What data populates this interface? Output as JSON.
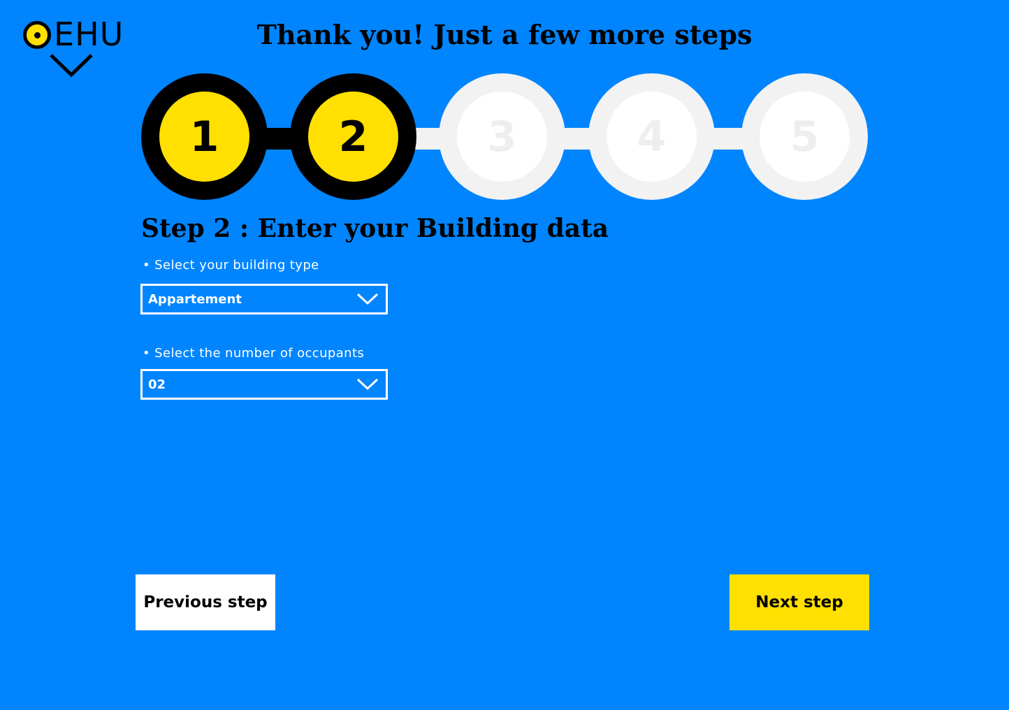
{
  "brand": {
    "name": "EHU",
    "icons": [
      "eye-icon",
      "chevron-down-icon"
    ]
  },
  "page": {
    "title": "Thank you! Just a few more steps"
  },
  "stepper": {
    "steps": [
      {
        "label": "1",
        "state": "done"
      },
      {
        "label": "2",
        "state": "current"
      },
      {
        "label": "3",
        "state": "todo"
      },
      {
        "label": "4",
        "state": "todo"
      },
      {
        "label": "5",
        "state": "todo"
      }
    ]
  },
  "form": {
    "section_title": "Step 2 : Enter your Building data",
    "building_type": {
      "label": "• Select your building type",
      "value": "Appartement",
      "icon": "chevron-down-icon"
    },
    "occupants": {
      "label": "• Select the number of occupants",
      "value": "02",
      "icon": "chevron-down-icon"
    }
  },
  "nav": {
    "previous_label": "Previous step",
    "next_label": "Next step"
  },
  "colors": {
    "background": "#0085FF",
    "accent": "#FFE000",
    "done_ring": "#000000",
    "todo_ring": "#F2F2F2",
    "text_on_bg": "#FFFFFF"
  }
}
